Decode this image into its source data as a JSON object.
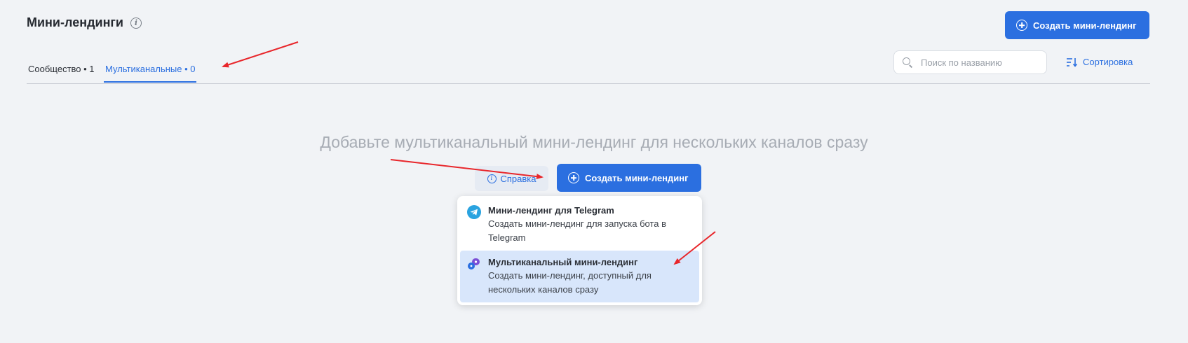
{
  "header": {
    "title": "Мини-лендинги",
    "create_label": "Создать мини-лендинг"
  },
  "tabs": [
    {
      "label": "Сообщество • 1",
      "active": false
    },
    {
      "label": "Мультиканальные • 0",
      "active": true
    }
  ],
  "search": {
    "placeholder": "Поиск по названию",
    "value": ""
  },
  "sort_label": "Сортировка",
  "empty_state": {
    "text": "Добавьте мультиканальный мини-лендинг для нескольких каналов сразу",
    "help_label": "Справка",
    "create_label": "Создать мини-лендинг"
  },
  "dropdown": {
    "items": [
      {
        "title": "Мини-лендинг для Telegram",
        "description": "Создать мини-лендинг для запуска бота в Telegram",
        "icon": "telegram-icon"
      },
      {
        "title": "Мультиканальный мини-лендинг",
        "description": "Создать мини-лендинг, доступный для нескольких каналов сразу",
        "icon": "multichannel-icon",
        "highlighted": true
      }
    ]
  },
  "colors": {
    "accent": "#2b6fe0",
    "background": "#f1f3f6",
    "annotation_arrow": "#e8262b",
    "hover": "#d8e6fb"
  }
}
